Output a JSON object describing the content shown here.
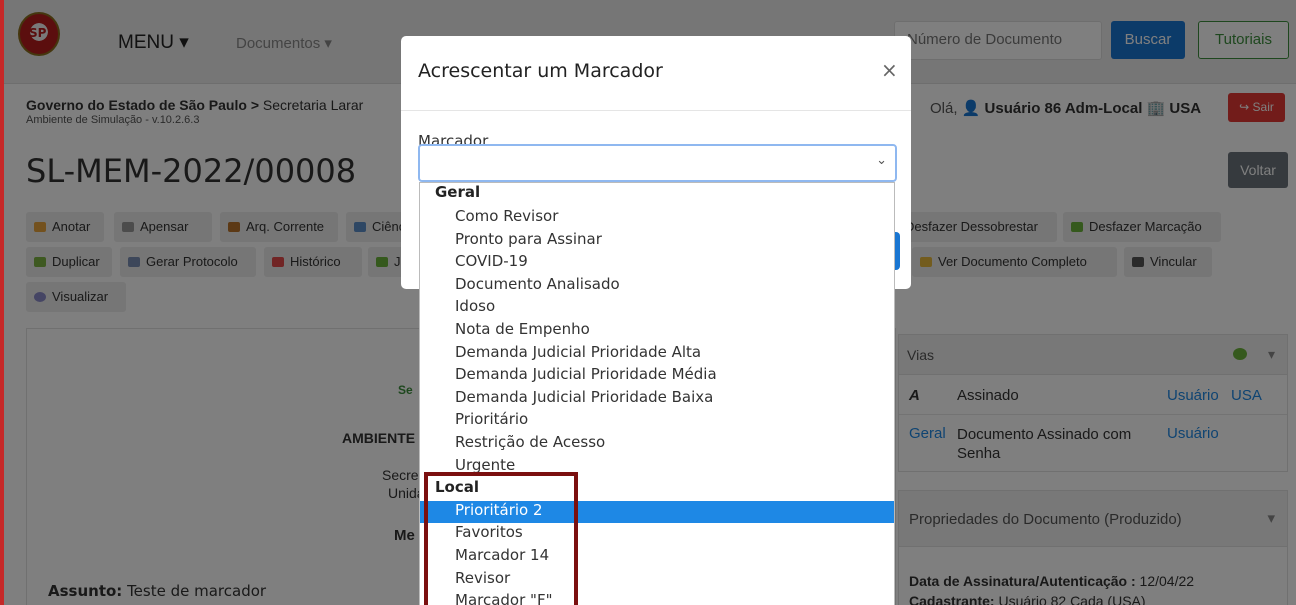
{
  "navbar": {
    "logo_text": "SP",
    "menu_label": "MENU ▾",
    "documentos_label": "Documentos ▾",
    "search_placeholder": "Número de Documento",
    "buscar_label": "Buscar",
    "tutoriais_label": "Tutoriais"
  },
  "header": {
    "breadcrumb_bold": "Governo do Estado de São Paulo >",
    "breadcrumb_rest": " Secretaria Larar",
    "env": "Ambiente de Simulação - v.10.2.6.3",
    "hello_prefix": "Olá,",
    "user_icon": "👤",
    "user": " Usuário 86 Adm-Local",
    "org_icon": "🏢",
    "org": " USA",
    "sair_label": "↪ Sair"
  },
  "doc": {
    "id": "SL-MEM-2022/00008",
    "voltar_label": "Voltar"
  },
  "actions_row1": [
    "Anotar",
    "Apensar",
    "Arq. Corrente",
    "Ciênc",
    "Desfazer Dessobrestar",
    "Desfazer Marcação"
  ],
  "actions_row2": [
    "Duplicar",
    "Gerar Protocolo",
    "Histórico",
    "J",
    "Ver Documento Completo",
    "Vincular"
  ],
  "actions_row3": [
    "Visualizar"
  ],
  "main": {
    "line1": "Se",
    "line2": "AMBIENTE D",
    "line3": "Secre",
    "line4": "Unida",
    "line5": "Me",
    "assunto_label": "Assunto:",
    "assunto_value": " Teste de marcador"
  },
  "vias": {
    "title": "Vias",
    "row1_a": "A",
    "row1_b": "Assinado",
    "row1_c": "Usuário",
    "row1_d": "USA",
    "row2_a": "Geral",
    "row2_b": "Documento Assinado com Senha",
    "row2_c": "Usuário"
  },
  "props": {
    "title": "Propriedades do Documento (Produzido)",
    "assin_label": "Data de Assinatura/Autenticação :",
    "assin_value": " 12/04/22",
    "cad_label": "Cadastrante:",
    "cad_value": " Usuário 82 Cada (USA)"
  },
  "modal": {
    "title": "Acrescentar um Marcador",
    "close": "×",
    "field_label": "Marcador",
    "chevron": "⌄"
  },
  "dropdown": {
    "group_geral": "Geral",
    "geral_items": [
      "Como Revisor",
      "Pronto para Assinar",
      "COVID-19",
      "Documento Analisado",
      "Idoso",
      "Nota de Empenho",
      "Demanda Judicial Prioridade Alta",
      "Demanda Judicial Prioridade Média",
      "Demanda Judicial Prioridade Baixa",
      "Prioritário",
      "Restrição de Acesso",
      "Urgente"
    ],
    "group_local": "Local",
    "local_items": [
      "Prioritário 2",
      "Favoritos",
      "Marcador 14",
      "Revisor",
      "Marcador \"F\""
    ],
    "selected": "Prioritário 2"
  }
}
